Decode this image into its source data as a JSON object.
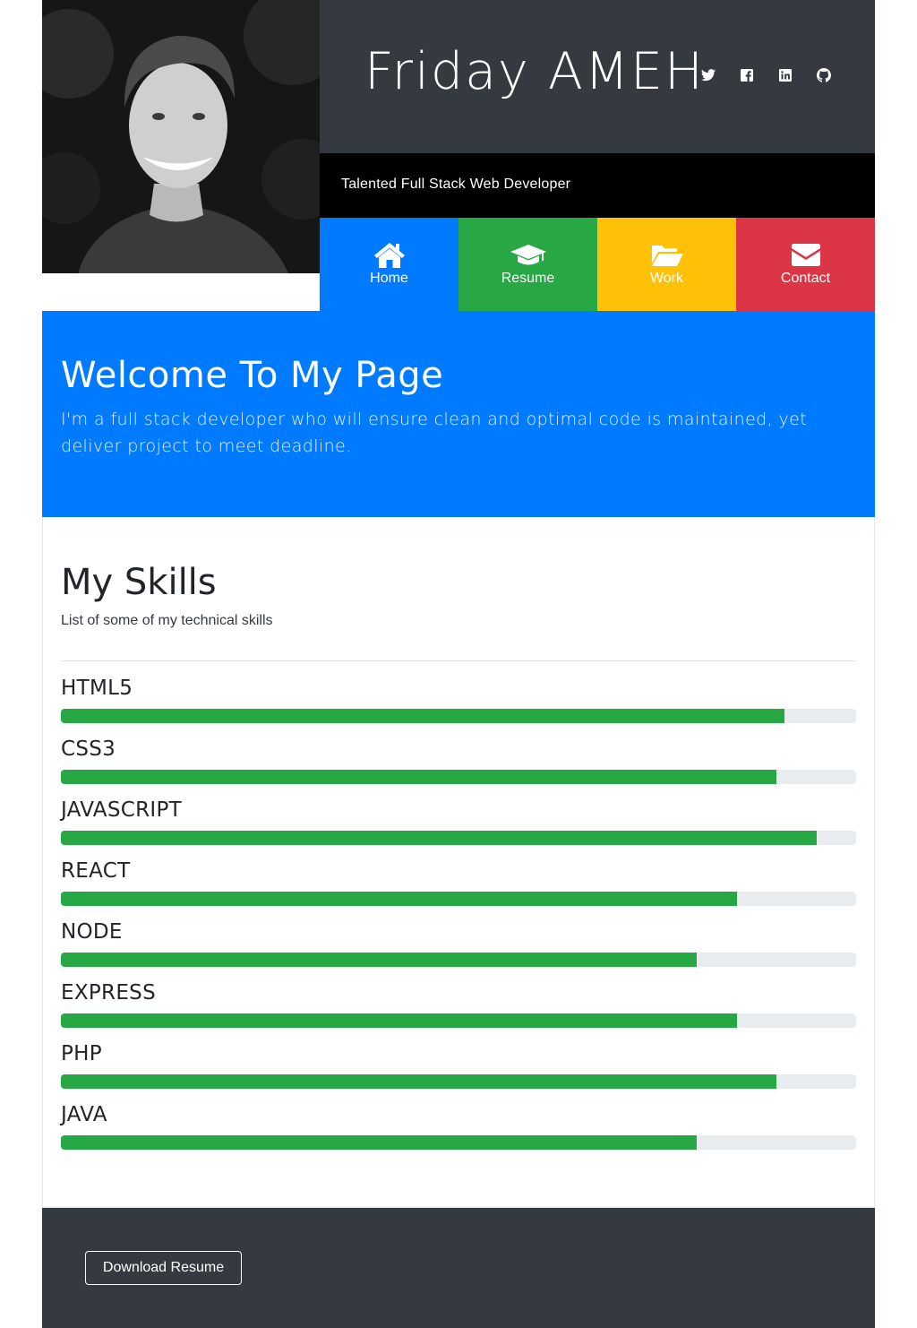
{
  "header": {
    "name": "Friday AMEH",
    "tagline": "Talented Full Stack Web Developer",
    "socials": [
      {
        "icon": "twitter-icon"
      },
      {
        "icon": "facebook-icon"
      },
      {
        "icon": "linkedin-icon"
      },
      {
        "icon": "github-icon"
      }
    ]
  },
  "nav": {
    "items": [
      {
        "label": "Home",
        "icon": "home-icon",
        "color": "#007bff"
      },
      {
        "label": "Resume",
        "icon": "graduation-cap-icon",
        "color": "#28a745"
      },
      {
        "label": "Work",
        "icon": "folder-open-icon",
        "color": "#ffc107"
      },
      {
        "label": "Contact",
        "icon": "envelope-icon",
        "color": "#dc3545"
      }
    ]
  },
  "jumbotron": {
    "title": "Welcome To My Page",
    "text": "I'm a full stack developer who will ensure clean and optimal code is maintained, yet deliver project to meet deadline."
  },
  "skills": {
    "title": "My Skills",
    "subtitle": "List of some of my technical skills",
    "items": [
      {
        "name": "HTML5",
        "level": 0.91
      },
      {
        "name": "CSS3",
        "level": 0.9
      },
      {
        "name": "JAVASCRIPT",
        "level": 0.95
      },
      {
        "name": "REACT",
        "level": 0.85
      },
      {
        "name": "NODE",
        "level": 0.8
      },
      {
        "name": "EXPRESS",
        "level": 0.85
      },
      {
        "name": "PHP",
        "level": 0.9
      },
      {
        "name": "JAVA",
        "level": 0.8
      }
    ],
    "bar_color": "#28a745"
  },
  "footer": {
    "download_label": "Download Resume"
  }
}
